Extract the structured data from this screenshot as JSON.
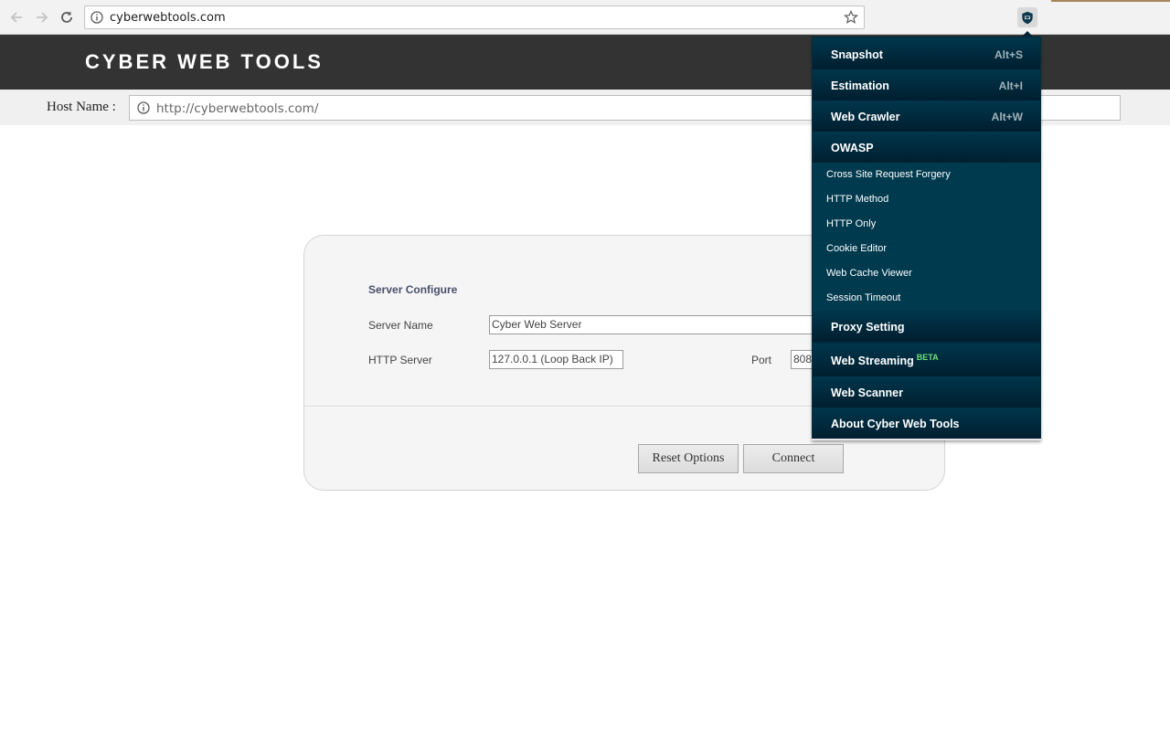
{
  "browser": {
    "url": "cyberwebtools.com"
  },
  "header": {
    "title": "CYBER WEB TOOLS"
  },
  "host": {
    "label": "Host Name :",
    "value": "http://cyberwebtools.com/"
  },
  "panel": {
    "title": "Server Configure",
    "server_name_label": "Server Name",
    "server_name_value": "Cyber Web Server",
    "http_server_label": "HTTP Server",
    "http_server_value": "127.0.0.1 (Loop Back IP)",
    "port_label": "Port",
    "port_value": "8088",
    "reset_label": "Reset Options",
    "connect_label": "Connect"
  },
  "menu": {
    "items": [
      {
        "label": "Snapshot",
        "shortcut": "Alt+S"
      },
      {
        "label": "Estimation",
        "shortcut": "Alt+I"
      },
      {
        "label": "Web Crawler",
        "shortcut": "Alt+W"
      },
      {
        "label": "OWASP",
        "shortcut": ""
      }
    ],
    "owasp_items": [
      "Cross Site Request Forgery",
      "HTTP Method",
      "HTTP Only",
      "Cookie Editor",
      "Web Cache Viewer",
      "Session Timeout"
    ],
    "lower_items": [
      {
        "label": "Proxy Setting"
      },
      {
        "label": "Web Streaming",
        "badge": "BETA"
      },
      {
        "label": "Web Scanner"
      },
      {
        "label": "About Cyber Web Tools"
      }
    ]
  },
  "colors": {
    "header_bg": "#333333",
    "menu_bg": "#002d3f",
    "beta_badge": "#6ee07a"
  },
  "icons": [
    "back-arrow-icon",
    "forward-arrow-icon",
    "reload-icon",
    "info-icon",
    "star-icon",
    "shield-icon"
  ]
}
